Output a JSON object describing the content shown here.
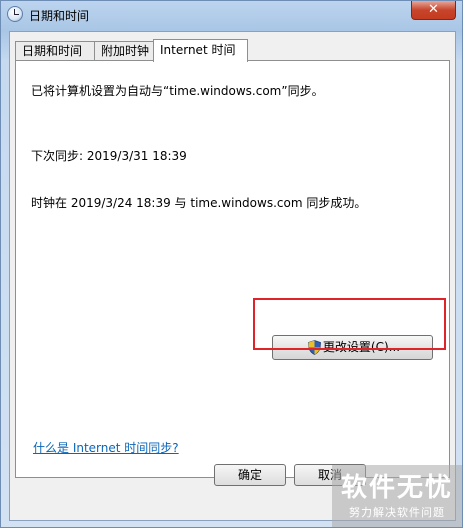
{
  "window": {
    "title": "日期和时间",
    "close_glyph": "✕"
  },
  "tabs": [
    {
      "label": "日期和时间"
    },
    {
      "label": "附加时钟"
    },
    {
      "label": "Internet 时间"
    }
  ],
  "internet_time": {
    "sync_setting": "已将计算机设置为自动与“time.windows.com”同步。",
    "next_sync": "下次同步: 2019/3/31 18:39",
    "last_sync": "时钟在 2019/3/24 18:39 与 time.windows.com 同步成功。",
    "change_button": "更改设置(C)...",
    "help_link": "什么是 Internet 时间同步?"
  },
  "footer": {
    "ok": "确定",
    "cancel": "取消"
  },
  "watermark": {
    "main": "软件无忧",
    "sub": "努力解决软件问题"
  },
  "colors": {
    "highlight": "#e0232a",
    "link": "#0a66b8"
  }
}
